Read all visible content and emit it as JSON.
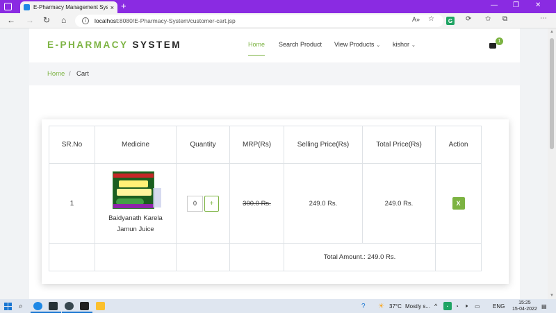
{
  "browser": {
    "tab_title": "E-Pharmacy Management Syste",
    "tab_close": "×",
    "new_tab": "+",
    "url_host": "localhost",
    "url_path": ":8080/E-Pharmacy-System/customer-cart.jsp",
    "info_glyph": "i",
    "read_aloud_glyph": "A»",
    "ext_glyph": "G"
  },
  "header": {
    "brand_part1": "E-PHARMACY",
    "brand_part2": "SYSTEM",
    "nav_home": "Home",
    "nav_search": "Search Product",
    "nav_view": "View Products",
    "nav_user": "kishor",
    "cart_count": "1"
  },
  "breadcrumb": {
    "home": "Home",
    "separator": "/",
    "current": "Cart"
  },
  "cart_table": {
    "headers": [
      "SR.No",
      "Medicine",
      "Quantity",
      "MRP(Rs)",
      "Selling Price(Rs)",
      "Total Price(Rs)",
      "Action"
    ],
    "rows": [
      {
        "sr": "1",
        "medicine_line1": "Baidyanath Karela",
        "medicine_line2": "Jamun Juice",
        "quantity": "0",
        "plus": "+",
        "mrp": "300.0 Rs.",
        "selling": "249.0 Rs.",
        "total": "249.0 Rs.",
        "action": "X"
      }
    ],
    "total_amount": "Total Amount.: 249.0 Rs."
  },
  "taskbar": {
    "temperature": "37°C",
    "weather": "Mostly s...",
    "lang": "ENG",
    "time": "15:25",
    "date": "15-04-2022"
  }
}
